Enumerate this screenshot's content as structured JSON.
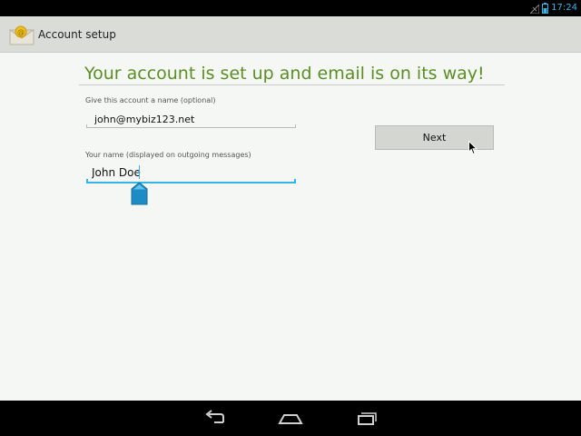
{
  "status_bar": {
    "time": "17:24",
    "icons": [
      "signal-icon",
      "battery-icon"
    ]
  },
  "action_bar": {
    "title": "Account setup",
    "icon": "email-app-icon"
  },
  "content": {
    "headline": "Your account is set up and email is on its way!",
    "account_name_label": "Give this account a name (optional)",
    "account_name_value": "john@mybiz123.net",
    "your_name_label": "Your name (displayed on outgoing messages)",
    "your_name_value": "John Doe",
    "next_label": "Next"
  },
  "nav_bar": {
    "buttons": [
      "back-icon",
      "home-icon",
      "recents-icon"
    ]
  },
  "colors": {
    "accent": "#33b5e5",
    "headline": "#5b8f25",
    "background": "#f5f7f4",
    "action_bar": "#dadcd8"
  }
}
